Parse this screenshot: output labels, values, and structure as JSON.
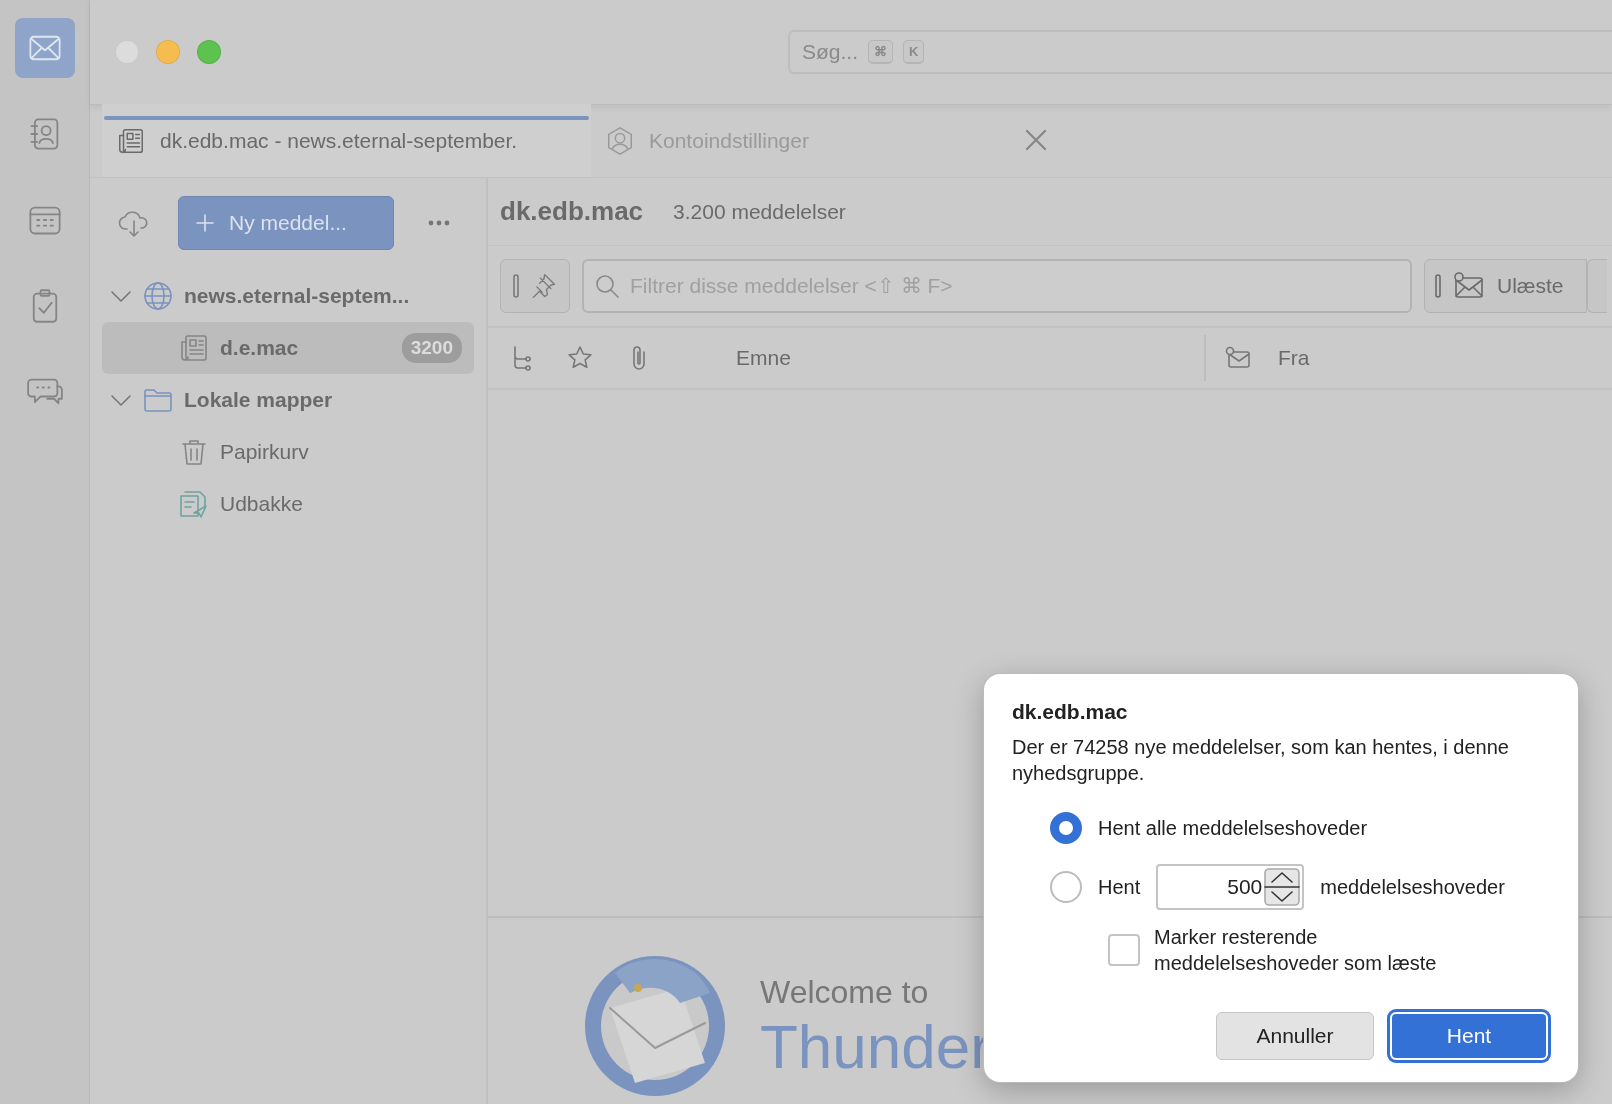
{
  "spaces": [
    {
      "kind": "mail",
      "selected": true
    },
    {
      "kind": "addressbook",
      "selected": false
    },
    {
      "kind": "calendar",
      "selected": false
    },
    {
      "kind": "tasks",
      "selected": false
    },
    {
      "kind": "chat",
      "selected": false
    }
  ],
  "search": {
    "placeholder": "Søg...",
    "keys": [
      "⌘",
      "K"
    ]
  },
  "tabs": [
    {
      "kind": "newsgroup",
      "label": "dk.edb.mac - news.eternal-september.",
      "selected": true,
      "closable": false
    },
    {
      "kind": "account",
      "label": "Kontoindstillinger",
      "selected": false,
      "closable": true
    }
  ],
  "folder_pane": {
    "new_message_button": "Ny meddel...",
    "folders": [
      {
        "kind": "server",
        "name": "news.eternal-septem...",
        "expanded": true,
        "selected": false,
        "children": [
          {
            "kind": "newsgroup",
            "name": "d.e.mac",
            "badge": "3200",
            "selected": true
          }
        ]
      },
      {
        "kind": "local",
        "name": "Lokale mapper",
        "expanded": true,
        "selected": false,
        "children": [
          {
            "kind": "trash",
            "name": "Papirkurv",
            "selected": false
          },
          {
            "kind": "outbox",
            "name": "Udbakke",
            "selected": false
          }
        ]
      }
    ]
  },
  "message_pane": {
    "folder_name": "dk.edb.mac",
    "count": "3.200 meddelelser",
    "filter_placeholder": "Filtrer disse meddelelser <⇧ ⌘ F>",
    "quick_filters": [
      {
        "label": "Ulæste",
        "selected": false
      }
    ],
    "columns": [
      {
        "kind": "thread"
      },
      {
        "kind": "star"
      },
      {
        "kind": "attachment"
      },
      {
        "kind": "text",
        "label": "Emne"
      },
      {
        "kind": "correspondent"
      },
      {
        "kind": "text",
        "label": "Fra"
      }
    ]
  },
  "welcome": {
    "greeting": "Welcome to",
    "product": "Thunder"
  },
  "dialog": {
    "title": "dk.edb.mac",
    "message": "Der er 74258 nye meddelelser, som kan hentes, i denne nyhedsgruppe.",
    "options": [
      {
        "kind": "all",
        "label": "Hent alle meddelelseshoveder",
        "selected": true
      },
      {
        "kind": "count",
        "label": "Hent",
        "value": "500",
        "suffix": "meddelelseshoveder",
        "selected": false
      }
    ],
    "mark_rest": {
      "label": "Marker resterende meddelelseshoveder som læste",
      "checked": false
    },
    "buttons": [
      {
        "label": "Annuller",
        "default": false
      },
      {
        "label": "Hent",
        "default": true
      }
    ]
  }
}
